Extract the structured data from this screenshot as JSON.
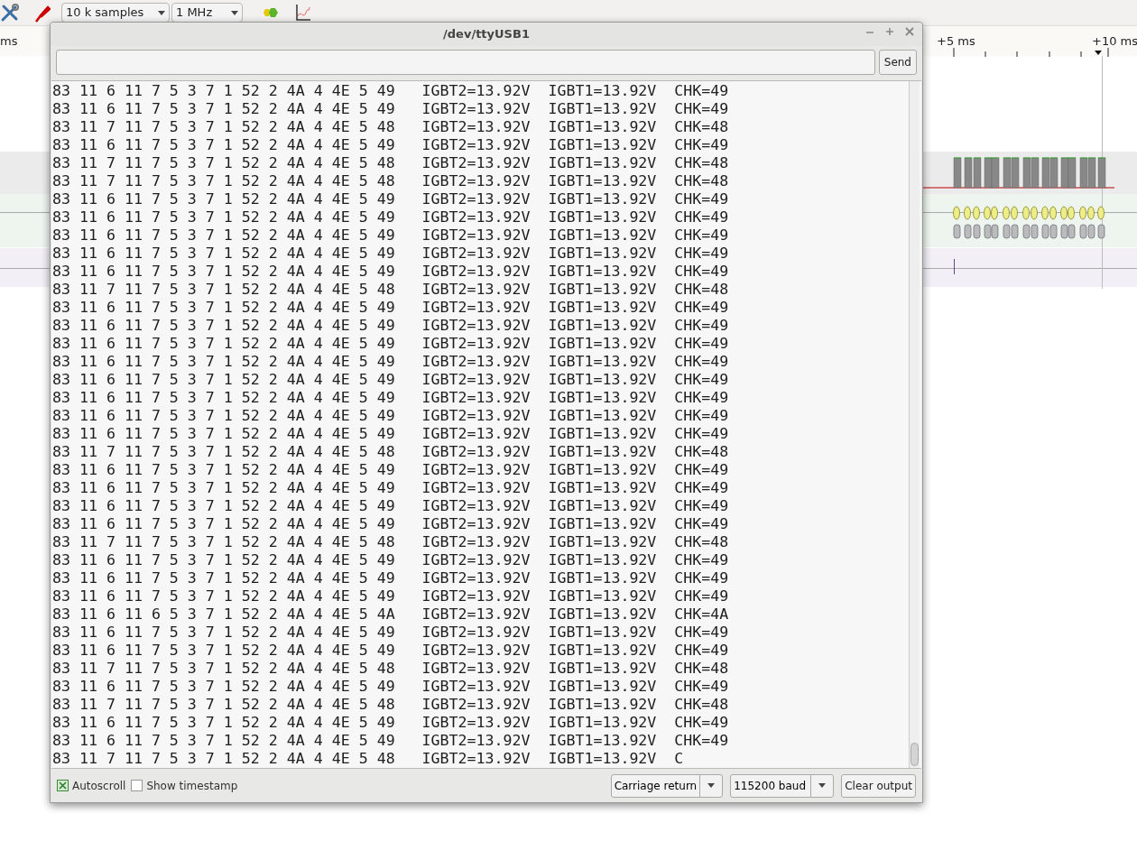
{
  "toolbar": {
    "samples": "10 k samples",
    "rate": "1 MHz"
  },
  "ruler": {
    "labels": [
      "ms",
      "+5 ms",
      "+10 ms"
    ]
  },
  "dialog": {
    "title": "/dev/ttyUSB1",
    "send_button": "Send",
    "lines": [
      "83 11 6 11 7 5 3 7 1 52 2 4A 4 4E 5 49   IGBT2=13.92V  IGBT1=13.92V  CHK=49",
      "83 11 6 11 7 5 3 7 1 52 2 4A 4 4E 5 49   IGBT2=13.92V  IGBT1=13.92V  CHK=49",
      "83 11 7 11 7 5 3 7 1 52 2 4A 4 4E 5 48   IGBT2=13.92V  IGBT1=13.92V  CHK=48",
      "83 11 6 11 7 5 3 7 1 52 2 4A 4 4E 5 49   IGBT2=13.92V  IGBT1=13.92V  CHK=49",
      "83 11 7 11 7 5 3 7 1 52 2 4A 4 4E 5 48   IGBT2=13.92V  IGBT1=13.92V  CHK=48",
      "83 11 7 11 7 5 3 7 1 52 2 4A 4 4E 5 48   IGBT2=13.92V  IGBT1=13.92V  CHK=48",
      "83 11 6 11 7 5 3 7 1 52 2 4A 4 4E 5 49   IGBT2=13.92V  IGBT1=13.92V  CHK=49",
      "83 11 6 11 7 5 3 7 1 52 2 4A 4 4E 5 49   IGBT2=13.92V  IGBT1=13.92V  CHK=49",
      "83 11 6 11 7 5 3 7 1 52 2 4A 4 4E 5 49   IGBT2=13.92V  IGBT1=13.92V  CHK=49",
      "83 11 6 11 7 5 3 7 1 52 2 4A 4 4E 5 49   IGBT2=13.92V  IGBT1=13.92V  CHK=49",
      "83 11 6 11 7 5 3 7 1 52 2 4A 4 4E 5 49   IGBT2=13.92V  IGBT1=13.92V  CHK=49",
      "83 11 7 11 7 5 3 7 1 52 2 4A 4 4E 5 48   IGBT2=13.92V  IGBT1=13.92V  CHK=48",
      "83 11 6 11 7 5 3 7 1 52 2 4A 4 4E 5 49   IGBT2=13.92V  IGBT1=13.92V  CHK=49",
      "83 11 6 11 7 5 3 7 1 52 2 4A 4 4E 5 49   IGBT2=13.92V  IGBT1=13.92V  CHK=49",
      "83 11 6 11 7 5 3 7 1 52 2 4A 4 4E 5 49   IGBT2=13.92V  IGBT1=13.92V  CHK=49",
      "83 11 6 11 7 5 3 7 1 52 2 4A 4 4E 5 49   IGBT2=13.92V  IGBT1=13.92V  CHK=49",
      "83 11 6 11 7 5 3 7 1 52 2 4A 4 4E 5 49   IGBT2=13.92V  IGBT1=13.92V  CHK=49",
      "83 11 6 11 7 5 3 7 1 52 2 4A 4 4E 5 49   IGBT2=13.92V  IGBT1=13.92V  CHK=49",
      "83 11 6 11 7 5 3 7 1 52 2 4A 4 4E 5 49   IGBT2=13.92V  IGBT1=13.92V  CHK=49",
      "83 11 6 11 7 5 3 7 1 52 2 4A 4 4E 5 49   IGBT2=13.92V  IGBT1=13.92V  CHK=49",
      "83 11 7 11 7 5 3 7 1 52 2 4A 4 4E 5 48   IGBT2=13.92V  IGBT1=13.92V  CHK=48",
      "83 11 6 11 7 5 3 7 1 52 2 4A 4 4E 5 49   IGBT2=13.92V  IGBT1=13.92V  CHK=49",
      "83 11 6 11 7 5 3 7 1 52 2 4A 4 4E 5 49   IGBT2=13.92V  IGBT1=13.92V  CHK=49",
      "83 11 6 11 7 5 3 7 1 52 2 4A 4 4E 5 49   IGBT2=13.92V  IGBT1=13.92V  CHK=49",
      "83 11 6 11 7 5 3 7 1 52 2 4A 4 4E 5 49   IGBT2=13.92V  IGBT1=13.92V  CHK=49",
      "83 11 7 11 7 5 3 7 1 52 2 4A 4 4E 5 48   IGBT2=13.92V  IGBT1=13.92V  CHK=48",
      "83 11 6 11 7 5 3 7 1 52 2 4A 4 4E 5 49   IGBT2=13.92V  IGBT1=13.92V  CHK=49",
      "83 11 6 11 7 5 3 7 1 52 2 4A 4 4E 5 49   IGBT2=13.92V  IGBT1=13.92V  CHK=49",
      "83 11 6 11 7 5 3 7 1 52 2 4A 4 4E 5 49   IGBT2=13.92V  IGBT1=13.92V  CHK=49",
      "83 11 6 11 6 5 3 7 1 52 2 4A 4 4E 5 4A   IGBT2=13.92V  IGBT1=13.92V  CHK=4A",
      "83 11 6 11 7 5 3 7 1 52 2 4A 4 4E 5 49   IGBT2=13.92V  IGBT1=13.92V  CHK=49",
      "83 11 6 11 7 5 3 7 1 52 2 4A 4 4E 5 49   IGBT2=13.92V  IGBT1=13.92V  CHK=49",
      "83 11 7 11 7 5 3 7 1 52 2 4A 4 4E 5 48   IGBT2=13.92V  IGBT1=13.92V  CHK=48",
      "83 11 6 11 7 5 3 7 1 52 2 4A 4 4E 5 49   IGBT2=13.92V  IGBT1=13.92V  CHK=49",
      "83 11 7 11 7 5 3 7 1 52 2 4A 4 4E 5 48   IGBT2=13.92V  IGBT1=13.92V  CHK=48",
      "83 11 6 11 7 5 3 7 1 52 2 4A 4 4E 5 49   IGBT2=13.92V  IGBT1=13.92V  CHK=49",
      "83 11 6 11 7 5 3 7 1 52 2 4A 4 4E 5 49   IGBT2=13.92V  IGBT1=13.92V  CHK=49",
      "83 11 7 11 7 5 3 7 1 52 2 4A 4 4E 5 48   IGBT2=13.92V  IGBT1=13.92V  C"
    ],
    "autoscroll": {
      "label": "Autoscroll",
      "checked": true
    },
    "timestamp": {
      "label": "Show timestamp",
      "checked": false
    },
    "line_ending": "Carriage return",
    "baud": "115200 baud",
    "clear_button": "Clear output"
  }
}
